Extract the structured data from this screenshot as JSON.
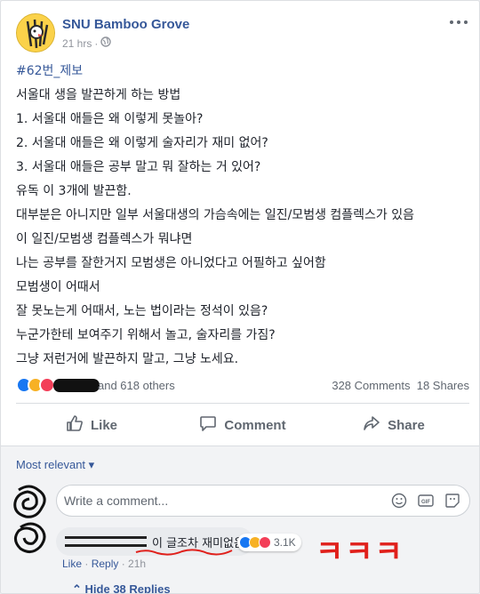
{
  "post": {
    "page_name": "SNU Bamboo Grove",
    "timestamp": "21 hrs",
    "separator": "·",
    "hashtag": "#62번_제보",
    "lines": [
      "서울대 생을 발끈하게 하는 방법",
      "1. 서울대 애들은 왜 이렇게 못놀아?",
      "2. 서울대 애들은 왜 이렇게 술자리가 재미 없어?",
      "3. 서울대 애들은 공부 말고 뭐 잘하는 거 있어?",
      "유독 이 3개에 발끈함.",
      "대부분은 아니지만 일부 서울대생의 가슴속에는 일진/모범생 컴플렉스가 있음",
      "이 일진/모범생 컴플렉스가 뭐냐면",
      "나는 공부를 잘한거지 모범생은 아니었다고 어필하고 싶어함",
      "모범생이 어때서",
      "잘 못노는게 어때서, 노는 법이라는 정석이 있음?",
      "누군가한테 보여주기 위해서 놀고, 술자리를 가짐?",
      "그냥 저런거에 발끈하지 말고, 그냥 노세요."
    ]
  },
  "stats": {
    "others": "and 618 others",
    "comments": "328 Comments",
    "shares": "18 Shares"
  },
  "actions": {
    "like": "Like",
    "comment": "Comment",
    "share": "Share"
  },
  "comments": {
    "sort": "Most relevant",
    "placeholder": "Write a comment...",
    "top_comment": {
      "text": "이 글조차 재미없음",
      "reaction_count": "3.1K",
      "like": "Like",
      "reply": "Reply",
      "time": "21h"
    },
    "hide_replies": "Hide 38 Replies"
  },
  "annotation": "ㅋㅋㅋ",
  "colors": {
    "link": "#365899",
    "like_blue": "#1877f2",
    "haha_yellow": "#f7b125",
    "love_red": "#f33e58",
    "annotation_red": "#e0201b"
  }
}
